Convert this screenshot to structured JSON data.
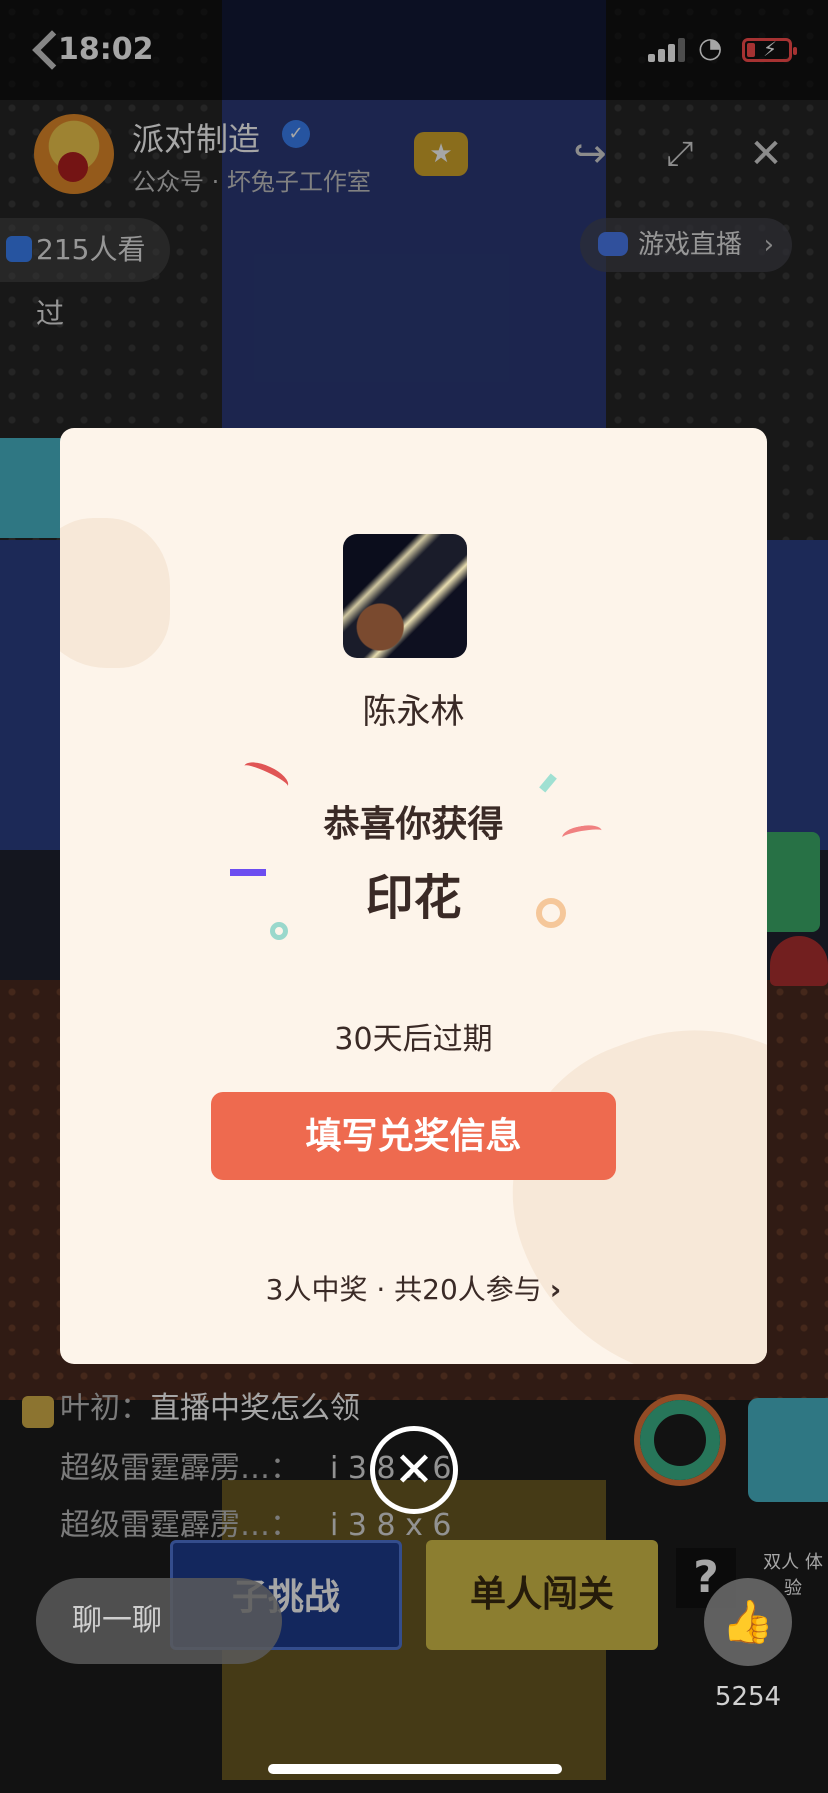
{
  "status_bar": {
    "time": "18:02"
  },
  "header": {
    "title": "派对制造",
    "subtitle": "公众号 · 坏兔子工作室",
    "viewers": "215人看过",
    "live_tag": "游戏直播"
  },
  "modal": {
    "winner_name": "陈永林",
    "congrats": "恭喜你获得",
    "prize": "印花",
    "expiry": "30天后过期",
    "claim_button": "填写兑奖信息",
    "participants": "3人中奖 · 共20人参与"
  },
  "chat": {
    "messages": [
      {
        "nick": "叶初：",
        "text": "直播中奖怎么领"
      },
      {
        "nick": "超级雷霆霹雳…：",
        "text": "i 3 8 x 6"
      },
      {
        "nick": "超级雷霆霹雳…：",
        "text": "i 3 8 x 6"
      }
    ]
  },
  "game": {
    "challenge_button": "子挑战",
    "solo_button": "单人闯关",
    "help": "?",
    "duo": "双人\n体验"
  },
  "bottom": {
    "chat_placeholder": "聊一聊",
    "like_count": "5254"
  },
  "colors": {
    "modal_bg": "#fdf4ea",
    "claim_button": "#ee6a4f",
    "text_dark": "#3a2a26"
  },
  "icons": {
    "back": "chevron-left-icon",
    "verified": "verified-check-icon",
    "share": "share-arrow-icon",
    "shrink": "minimize-icon",
    "close": "close-icon",
    "like": "thumbs-up-icon",
    "modal_close": "circle-close-icon"
  }
}
